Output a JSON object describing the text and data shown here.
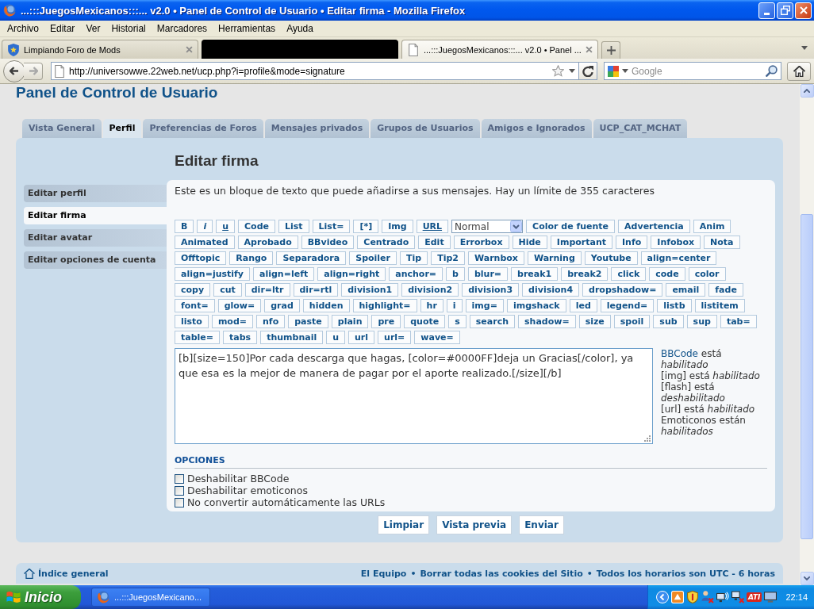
{
  "window": {
    "title": "...:::JuegosMexicanos:::... v2.0 • Panel de Control de Usuario • Editar firma - Mozilla Firefox"
  },
  "menu": [
    "Archivo",
    "Editar",
    "Ver",
    "Historial",
    "Marcadores",
    "Herramientas",
    "Ayuda"
  ],
  "browser_tabs": [
    {
      "kind": "favicon",
      "title": "Limpiando Foro de Mods",
      "selected": false
    },
    {
      "kind": "redacted",
      "selected": false
    },
    {
      "kind": "document",
      "title": "...:::JuegosMexicanos:::... v2.0 • Panel ...",
      "selected": true
    }
  ],
  "address_bar": {
    "url": "http://universowwe.22web.net/ucp.php?i=profile&mode=signature"
  },
  "search": {
    "placeholder": "Google"
  },
  "page": {
    "heading": "Panel de Control de Usuario",
    "tabs": [
      {
        "label": "Vista General",
        "selected": false
      },
      {
        "label": "Perfil",
        "selected": true
      },
      {
        "label": "Preferencias de Foros",
        "selected": false
      },
      {
        "label": "Mensajes privados",
        "selected": false
      },
      {
        "label": "Grupos de Usuarios",
        "selected": false
      },
      {
        "label": "Amigos e Ignorados",
        "selected": false
      },
      {
        "label": "UCP_CAT_MCHAT",
        "selected": false
      }
    ],
    "sidebar": [
      {
        "label": "Editar perfil",
        "selected": false
      },
      {
        "label": "Editar firma",
        "selected": true
      },
      {
        "label": "Editar avatar",
        "selected": false
      },
      {
        "label": "Editar opciones de cuenta",
        "selected": false
      }
    ],
    "title": "Editar firma",
    "description": "Este es un bloque de texto que puede añadirse a sus mensajes. Hay un límite de 355 caracteres",
    "bbcode_rows": [
      [
        {
          "kind": "button",
          "label": "B"
        },
        {
          "kind": "italic",
          "label": "i"
        },
        {
          "kind": "underline",
          "label": "u"
        },
        {
          "kind": "button",
          "label": "Code"
        },
        {
          "kind": "button",
          "label": "List"
        },
        {
          "kind": "button",
          "label": "List="
        },
        {
          "kind": "button",
          "label": "[*]"
        },
        {
          "kind": "button",
          "label": "Img"
        },
        {
          "kind": "underline",
          "label": "URL"
        },
        {
          "kind": "select",
          "label": "Normal"
        },
        {
          "kind": "button",
          "label": "Color de fuente"
        },
        {
          "kind": "button",
          "label": "Advertencia"
        },
        {
          "kind": "button",
          "label": "Anim"
        }
      ],
      [
        {
          "kind": "button",
          "label": "Animated"
        },
        {
          "kind": "button",
          "label": "Aprobado"
        },
        {
          "kind": "button",
          "label": "BBvideo"
        },
        {
          "kind": "button",
          "label": "Centrado"
        },
        {
          "kind": "button",
          "label": "Edit"
        },
        {
          "kind": "button",
          "label": "Errorbox"
        },
        {
          "kind": "button",
          "label": "Hide"
        },
        {
          "kind": "button",
          "label": "Important"
        },
        {
          "kind": "button",
          "label": "Info"
        },
        {
          "kind": "button",
          "label": "Infobox"
        },
        {
          "kind": "button",
          "label": "Nota"
        }
      ],
      [
        {
          "kind": "button",
          "label": "Offtopic"
        },
        {
          "kind": "button",
          "label": "Rango"
        },
        {
          "kind": "button",
          "label": "Separadora"
        },
        {
          "kind": "button",
          "label": "Spoiler"
        },
        {
          "kind": "button",
          "label": "Tip"
        },
        {
          "kind": "button",
          "label": "Tip2"
        },
        {
          "kind": "button",
          "label": "Warnbox"
        },
        {
          "kind": "button",
          "label": "Warning"
        },
        {
          "kind": "button",
          "label": "Youtube"
        },
        {
          "kind": "button",
          "label": "align=center"
        }
      ],
      [
        {
          "kind": "button",
          "label": "align=justify"
        },
        {
          "kind": "button",
          "label": "align=left"
        },
        {
          "kind": "button",
          "label": "align=right"
        },
        {
          "kind": "button",
          "label": "anchor="
        },
        {
          "kind": "button",
          "label": "b"
        },
        {
          "kind": "button",
          "label": "blur="
        },
        {
          "kind": "button",
          "label": "break1"
        },
        {
          "kind": "button",
          "label": "break2"
        },
        {
          "kind": "button",
          "label": "click"
        },
        {
          "kind": "button",
          "label": "code"
        },
        {
          "kind": "button",
          "label": "color"
        }
      ],
      [
        {
          "kind": "button",
          "label": "copy"
        },
        {
          "kind": "button",
          "label": "cut"
        },
        {
          "kind": "button",
          "label": "dir=ltr"
        },
        {
          "kind": "button",
          "label": "dir=rtl"
        },
        {
          "kind": "button",
          "label": "division1"
        },
        {
          "kind": "button",
          "label": "division2"
        },
        {
          "kind": "button",
          "label": "division3"
        },
        {
          "kind": "button",
          "label": "division4"
        },
        {
          "kind": "button",
          "label": "dropshadow="
        },
        {
          "kind": "button",
          "label": "email"
        },
        {
          "kind": "button",
          "label": "fade"
        }
      ],
      [
        {
          "kind": "button",
          "label": "font="
        },
        {
          "kind": "button",
          "label": "glow="
        },
        {
          "kind": "button",
          "label": "grad"
        },
        {
          "kind": "button",
          "label": "hidden"
        },
        {
          "kind": "button",
          "label": "highlight="
        },
        {
          "kind": "button",
          "label": "hr"
        },
        {
          "kind": "button",
          "label": "i"
        },
        {
          "kind": "button",
          "label": "img="
        },
        {
          "kind": "button",
          "label": "imgshack"
        },
        {
          "kind": "button",
          "label": "led"
        },
        {
          "kind": "button",
          "label": "legend="
        },
        {
          "kind": "button",
          "label": "listb"
        },
        {
          "kind": "button",
          "label": "listitem"
        }
      ],
      [
        {
          "kind": "button",
          "label": "listo"
        },
        {
          "kind": "button",
          "label": "mod="
        },
        {
          "kind": "button",
          "label": "nfo"
        },
        {
          "kind": "button",
          "label": "paste"
        },
        {
          "kind": "button",
          "label": "plain"
        },
        {
          "kind": "button",
          "label": "pre"
        },
        {
          "kind": "button",
          "label": "quote"
        },
        {
          "kind": "button",
          "label": "s"
        },
        {
          "kind": "button",
          "label": "search"
        },
        {
          "kind": "button",
          "label": "shadow="
        },
        {
          "kind": "button",
          "label": "size"
        },
        {
          "kind": "button",
          "label": "spoil"
        },
        {
          "kind": "button",
          "label": "sub"
        },
        {
          "kind": "button",
          "label": "sup"
        },
        {
          "kind": "button",
          "label": "tab="
        }
      ],
      [
        {
          "kind": "button",
          "label": "table="
        },
        {
          "kind": "button",
          "label": "tabs"
        },
        {
          "kind": "button",
          "label": "thumbnail"
        },
        {
          "kind": "button",
          "label": "u"
        },
        {
          "kind": "button",
          "label": "url"
        },
        {
          "kind": "button",
          "label": "url="
        },
        {
          "kind": "button",
          "label": "wave="
        }
      ]
    ],
    "signature": {
      "value": "[b][size=150]Por cada descarga que hagas, [color=#0000FF]deja un Gracias[/color], ya que esa es la mejor de manera de pagar por el aporte realizado.[/size][/b]"
    },
    "status_notes": [
      {
        "link": "BBCode",
        "text": "está *habilitado*"
      },
      {
        "text": "[img] está *habilitado*"
      },
      {
        "text": "[flash] está *deshabilitado*"
      },
      {
        "text": "[url] está *habilitado*"
      },
      {
        "text": "Emoticonos están *habilitados*"
      }
    ],
    "options": {
      "title": "OPCIONES",
      "items": [
        {
          "label": "Deshabilitar BBCode",
          "checked": false
        },
        {
          "label": "Deshabilitar emoticonos",
          "checked": false
        },
        {
          "label": "No convertir automáticamente las URLs",
          "checked": false
        }
      ]
    },
    "buttons": [
      "Limpiar",
      "Vista previa",
      "Enviar"
    ],
    "footer": {
      "home_link": "Índice general",
      "links": [
        "El Equipo",
        "Borrar todas las cookies del Sitio",
        "Todos los horarios son UTC - 6 horas"
      ],
      "separator": "•"
    }
  },
  "taskbar": {
    "start_label": "Inicio",
    "tasks": [
      {
        "label": "...:::JuegosMexicano..."
      }
    ],
    "tray_badge": "ATI",
    "clock": "22:14"
  }
}
